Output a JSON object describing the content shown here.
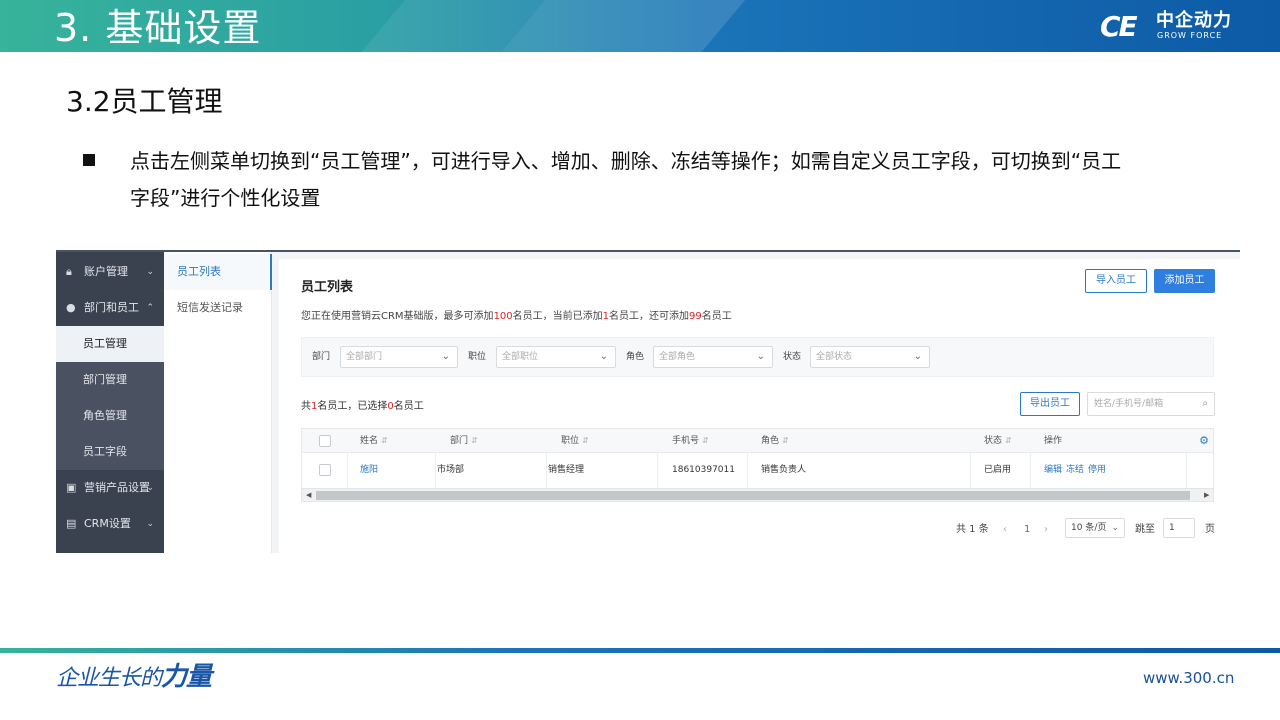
{
  "slide": {
    "title": "3. 基础设置",
    "section_title": "3.2员工管理",
    "bullet_text": "点击左侧菜单切换到“员工管理”，可进行导入、增加、删除、冻结等操作；如需自定义员工字段，可切换到“员工字段”进行个性化设置",
    "logo_mark": "CE",
    "logo_cn": "中企动力",
    "logo_en": "GROW FORCE",
    "footer_slogan_a": "企业生长的",
    "footer_slogan_b": "力量",
    "footer_url": "www.300.cn"
  },
  "app": {
    "sidebar": {
      "items": [
        {
          "label": "账户管理",
          "icon": "lock-icon",
          "chevron": "⌄"
        },
        {
          "label": "部门和员工",
          "icon": "user-icon",
          "chevron": "⌃"
        },
        {
          "label": "营销产品设置",
          "icon": "product-icon",
          "chevron": "⌄"
        },
        {
          "label": "CRM设置",
          "icon": "crm-icon",
          "chevron": "⌄"
        }
      ],
      "subitems": [
        "员工管理",
        "部门管理",
        "角色管理",
        "员工字段"
      ]
    },
    "subnav": [
      "员工列表",
      "短信发送记录"
    ],
    "panel": {
      "title": "员工列表",
      "import_label": "导入员工",
      "add_label": "添加员工",
      "notice": {
        "a": "您正在使用营销云CRM基础版，最多可添加",
        "max": "100",
        "b": "名员工，当前已添加",
        "added": "1",
        "c": "名员工，还可添加",
        "remain": "99",
        "d": "名员工"
      },
      "filters": [
        {
          "label": "部门",
          "placeholder": "全部部门"
        },
        {
          "label": "职位",
          "placeholder": "全部职位"
        },
        {
          "label": "角色",
          "placeholder": "全部角色"
        },
        {
          "label": "状态",
          "placeholder": "全部状态"
        }
      ],
      "count": {
        "a": "共",
        "total": "1",
        "b": "名员工，已选择",
        "selected": "0",
        "c": "名员工"
      },
      "export_label": "导出员工",
      "search_placeholder": "姓名/手机号/邮箱",
      "columns": [
        "姓名",
        "部门",
        "职位",
        "手机号",
        "角色",
        "状态",
        "操作"
      ],
      "rows": [
        {
          "name": "施阳",
          "dept": "市场部",
          "position": "销售经理",
          "phone": "18610397011",
          "role": "销售负责人",
          "status": "已启用",
          "actions": [
            "编辑",
            "冻结",
            "停用"
          ]
        }
      ],
      "pager": {
        "total": "共 1 条",
        "prev": "‹",
        "current": "1",
        "next": "›",
        "page_size": "10 条/页",
        "goto_label": "跳至",
        "goto_value": "1",
        "page_unit": "页"
      }
    }
  },
  "colors": {
    "accent": "#2a78c8",
    "sidebar_bg": "#3a4250",
    "warning_red": "#e02020"
  }
}
